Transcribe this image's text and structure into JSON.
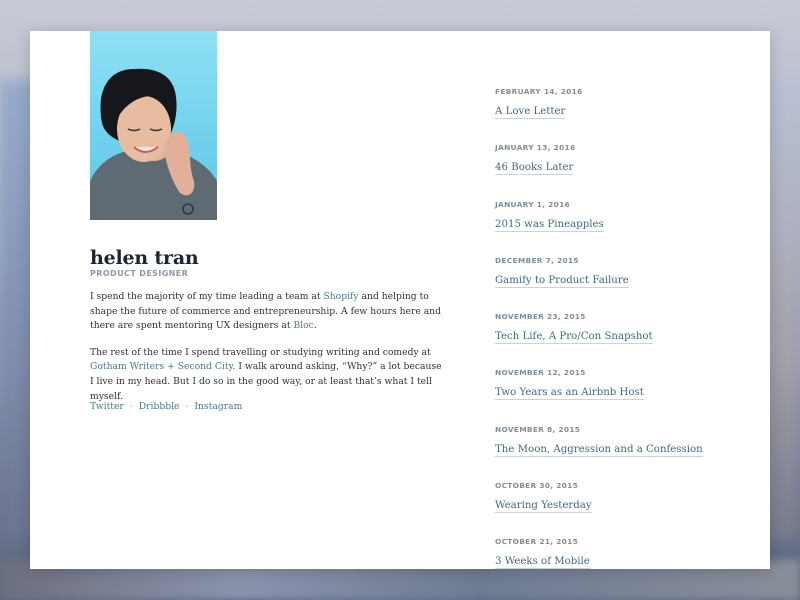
{
  "profile": {
    "name": "helen tran",
    "role": "PRODUCT DESIGNER",
    "bio_p1": {
      "t1": "I spend the majority of my time leading a team at ",
      "link1": "Shopify",
      "t2": " and helping to shape the future of commerce and entrepreneurship. A few hours here and there are spent mentoring UX designers at ",
      "link2": "Bloc",
      "t3": "."
    },
    "bio_p2": {
      "t1": "The rest of the time I spend travelling or studying writing and comedy at ",
      "link1": "Gotham Writers + Second City",
      "t2": ". I walk around asking, “Why?” a lot because I live in my head. But I do so in the good way, or at least that’s what I tell myself."
    },
    "social": [
      "Twitter",
      "Dribbble",
      "Instagram"
    ],
    "separator": "·"
  },
  "posts": [
    {
      "date": "FEBRUARY 14, 2016",
      "title": "A Love Letter"
    },
    {
      "date": "JANUARY 13, 2016",
      "title": "46 Books Later"
    },
    {
      "date": "JANUARY 1, 2016",
      "title": "2015 was Pineapples"
    },
    {
      "date": "DECEMBER 7, 2015",
      "title": "Gamify to Product Failure"
    },
    {
      "date": "NOVEMBER 23, 2015",
      "title": "Tech Life, A Pro/Con Snapshot"
    },
    {
      "date": "NOVEMBER 12, 2015",
      "title": "Two Years as an Airbnb Host"
    },
    {
      "date": "NOVEMBER 8, 2015",
      "title": "The Moon, Aggression and a Confession"
    },
    {
      "date": "OCTOBER 30, 2015",
      "title": "Wearing Yesterday"
    },
    {
      "date": "OCTOBER 21, 2015",
      "title": "3 Weeks of Mobile"
    }
  ],
  "colors": {
    "link": "#4a7592",
    "heading": "#1d2433",
    "muted": "#8c98a8",
    "photo_bg": "#74d3ee"
  }
}
